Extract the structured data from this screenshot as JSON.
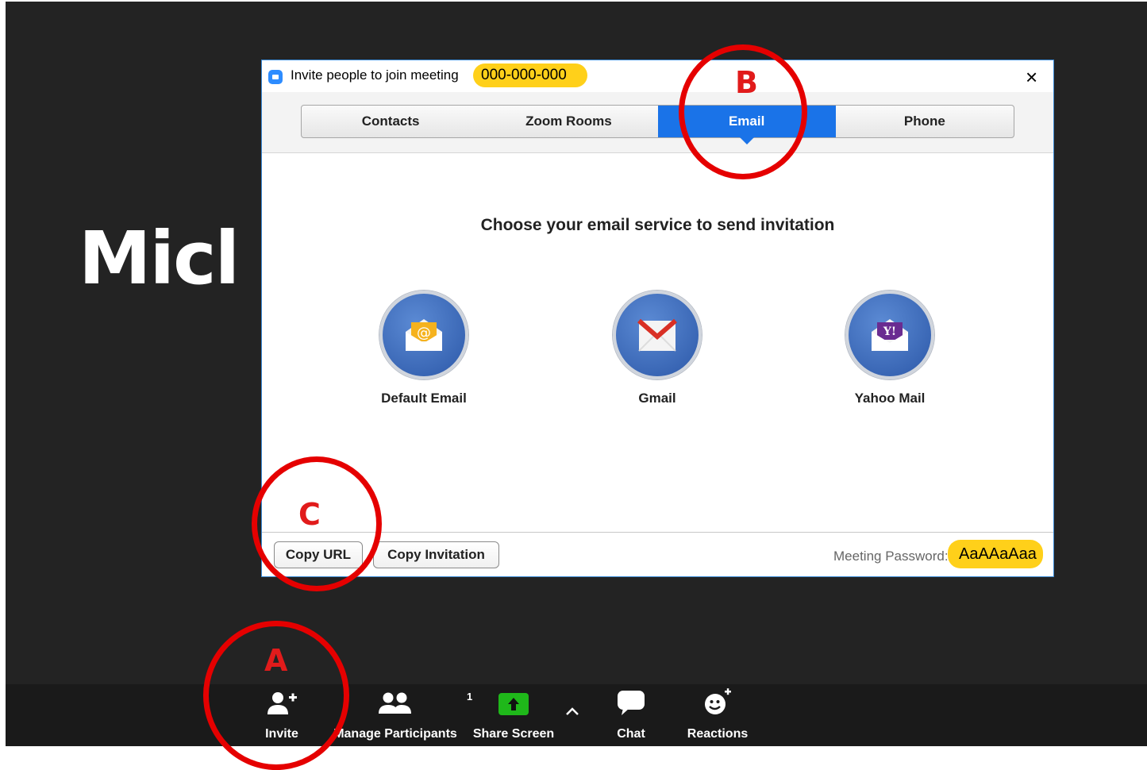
{
  "background": {
    "participant_name_partial": "Micl"
  },
  "dialog": {
    "title": "Invite people to join meeting",
    "meeting_id": "000-000-000",
    "close_glyph": "×",
    "tabs": [
      {
        "label": "Contacts",
        "active": false
      },
      {
        "label": "Zoom Rooms",
        "active": false
      },
      {
        "label": "Email",
        "active": true
      },
      {
        "label": "Phone",
        "active": false
      }
    ],
    "heading": "Choose your email service to send invitation",
    "services": [
      {
        "label": "Default Email",
        "icon": "default-email-icon"
      },
      {
        "label": "Gmail",
        "icon": "gmail-icon"
      },
      {
        "label": "Yahoo Mail",
        "icon": "yahoo-mail-icon"
      }
    ],
    "footer": {
      "copy_url": "Copy URL",
      "copy_invitation": "Copy Invitation",
      "password_label": "Meeting Password:",
      "password_value": "AaAAaAaa"
    }
  },
  "toolbar": {
    "invite": "Invite",
    "manage_participants": "Manage Participants",
    "participant_count": "1",
    "share_screen": "Share Screen",
    "chat": "Chat",
    "reactions": "Reactions"
  },
  "annotations": {
    "a": "A",
    "b": "B",
    "c": "C"
  },
  "colors": {
    "accent": "#1a73e8",
    "highlight": "#ffd01a",
    "marker": "#e50000",
    "share_green": "#1fb81a"
  }
}
